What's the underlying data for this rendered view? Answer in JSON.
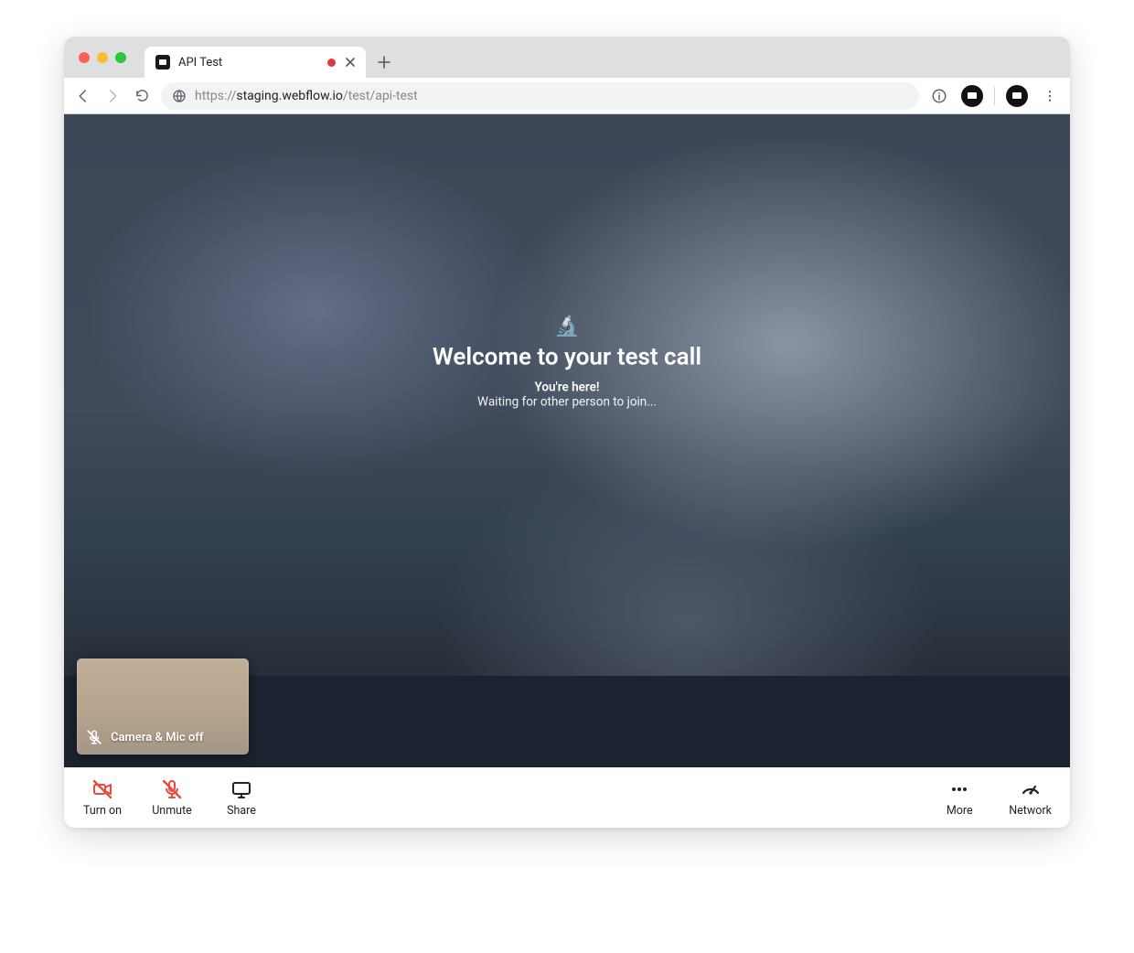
{
  "browser": {
    "tab": {
      "title": "API Test",
      "recording": true
    },
    "url": {
      "scheme": "https://",
      "host": "staging.webflow.io",
      "path": "/test/api-test"
    }
  },
  "welcome": {
    "emoji": "🔬",
    "heading": "Welcome to your test call",
    "line1": "You're here!",
    "line2": "Waiting for other person to join..."
  },
  "pip": {
    "status": "Camera & Mic off"
  },
  "controls": {
    "camera": "Turn on",
    "mic": "Unmute",
    "share": "Share",
    "more": "More",
    "network": "Network"
  },
  "colors": {
    "accent_red": "#e74c3c",
    "bottom_bar_bg": "#1c2330"
  }
}
